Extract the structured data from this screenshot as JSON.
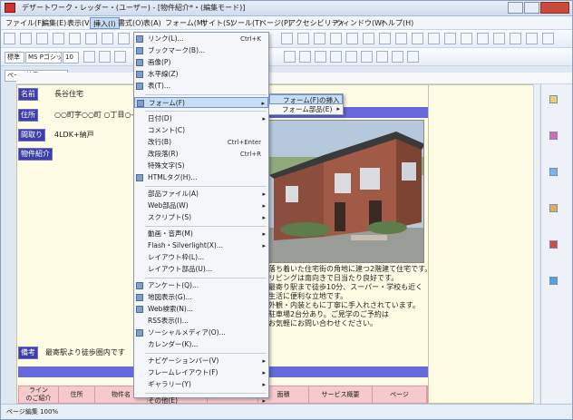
{
  "window": {
    "title": "デザートワーク・レッダー・(ユーザー) - [物件紹介*・(編集モード)]",
    "icon": "app-icon",
    "controls": [
      "minimize-icon",
      "maximize-icon",
      "close-icon"
    ]
  },
  "menubar": {
    "items": [
      "ファイル(F)",
      "編集(E)",
      "表示(V)",
      "挿入(I)",
      "書式(O)",
      "表(A)",
      "フォーム(M)",
      "サイト(S)",
      "ツール(T)",
      "ページ(P)",
      "アクセシビリティ",
      "ウィンドウ(W)",
      "ヘルプ(H)"
    ],
    "active_index": 3
  },
  "toolbar": {
    "style_select": "標準",
    "font_select": "MS Pゴシック",
    "size_select": "10",
    "view_select": "ページ編集"
  },
  "fields": [
    {
      "label": "名前",
      "value": "長谷住宅"
    },
    {
      "label": "住所",
      "value": "○○町字○○町 ○丁目○-○番地"
    },
    {
      "label": "間取り",
      "value": "4LDK+納戸"
    },
    {
      "label": "物件紹介",
      "value": ""
    }
  ],
  "description": [
    "落ち着いた住宅街の角地に建つ2階建て住宅です。",
    "リビングは南向きで日当たり良好です。",
    "最寄り駅まで徒歩10分、スーパー・学校も近く",
    "生活に便利な立地です。",
    "外観・内装ともに丁寧に手入れされています。",
    "駐車場2台分あり。ご見学のご予約は",
    "お気軽にお問い合わせください。"
  ],
  "bottom": {
    "label": "備考",
    "value": "最寄駅より徒歩圏内です"
  },
  "table_header": [
    "ライン\nのご紹介",
    "住所",
    "物件名",
    "間取り",
    "価格",
    "面積",
    "サービス概要",
    "ページ"
  ],
  "dropdown": {
    "groups": [
      [
        {
          "label": "リンク(L)...",
          "shortcut": "Ctrl+K",
          "icon": "link-icon"
        },
        {
          "label": "ブックマーク(B)...",
          "icon": "bookmark-icon"
        },
        {
          "label": "画像(P)",
          "icon": "image-icon"
        },
        {
          "label": "水平線(Z)",
          "icon": "hr-icon"
        },
        {
          "label": "表(T)...",
          "icon": "table-icon"
        }
      ],
      [
        {
          "label": "フォーム(F)",
          "submenu": true,
          "highlight": true,
          "icon": "form-icon"
        }
      ],
      [
        {
          "label": "日付(D)",
          "submenu": true
        },
        {
          "label": "コメント(C)"
        },
        {
          "label": "改行(B)",
          "shortcut": "Ctrl+Enter"
        },
        {
          "label": "改段落(R)",
          "shortcut": "Ctrl+R"
        },
        {
          "label": "特殊文字(S)"
        },
        {
          "label": "HTMLタグ(H)...",
          "icon": "html-icon"
        }
      ],
      [
        {
          "label": "部品ファイル(A)",
          "submenu": true
        },
        {
          "label": "Web部品(W)",
          "submenu": true
        },
        {
          "label": "スクリプト(S)",
          "submenu": true
        }
      ],
      [
        {
          "label": "動画・音声(M)",
          "submenu": true
        },
        {
          "label": "Flash・Silverlight(X)...",
          "submenu": true
        },
        {
          "label": "レイアウト枠(L)..."
        },
        {
          "label": "レイアウト部品(U)..."
        }
      ],
      [
        {
          "label": "アンケート(Q)...",
          "icon": "survey-icon"
        },
        {
          "label": "地図表示(G)...",
          "icon": "map-icon"
        },
        {
          "label": "Web検索(N)...",
          "icon": "search-icon"
        },
        {
          "label": "RSS表示(I)..."
        },
        {
          "label": "ソーシャルメディア(O)...",
          "icon": "social-icon"
        },
        {
          "label": "カレンダー(K)..."
        }
      ],
      [
        {
          "label": "ナビゲーションバー(V)",
          "submenu": true
        },
        {
          "label": "フレームレイアウト(F)",
          "submenu": true
        },
        {
          "label": "ギャラリー(Y)",
          "submenu": true
        }
      ],
      [
        {
          "label": "その他(E)",
          "submenu": true
        }
      ]
    ]
  },
  "submenu": {
    "items": [
      {
        "label": "フォーム(F)の挿入",
        "highlight": true
      },
      {
        "label": "フォーム部品(E)",
        "submenu": true
      }
    ]
  },
  "colors": {
    "label_bg": "#3d3fa6",
    "band": "#6668dc",
    "editor_bg": "#fffce6",
    "table_header_bg": "#f6c9cc",
    "menu_highlight": "#c9ddf7"
  },
  "status": {
    "text": "ページ編集 100%"
  }
}
